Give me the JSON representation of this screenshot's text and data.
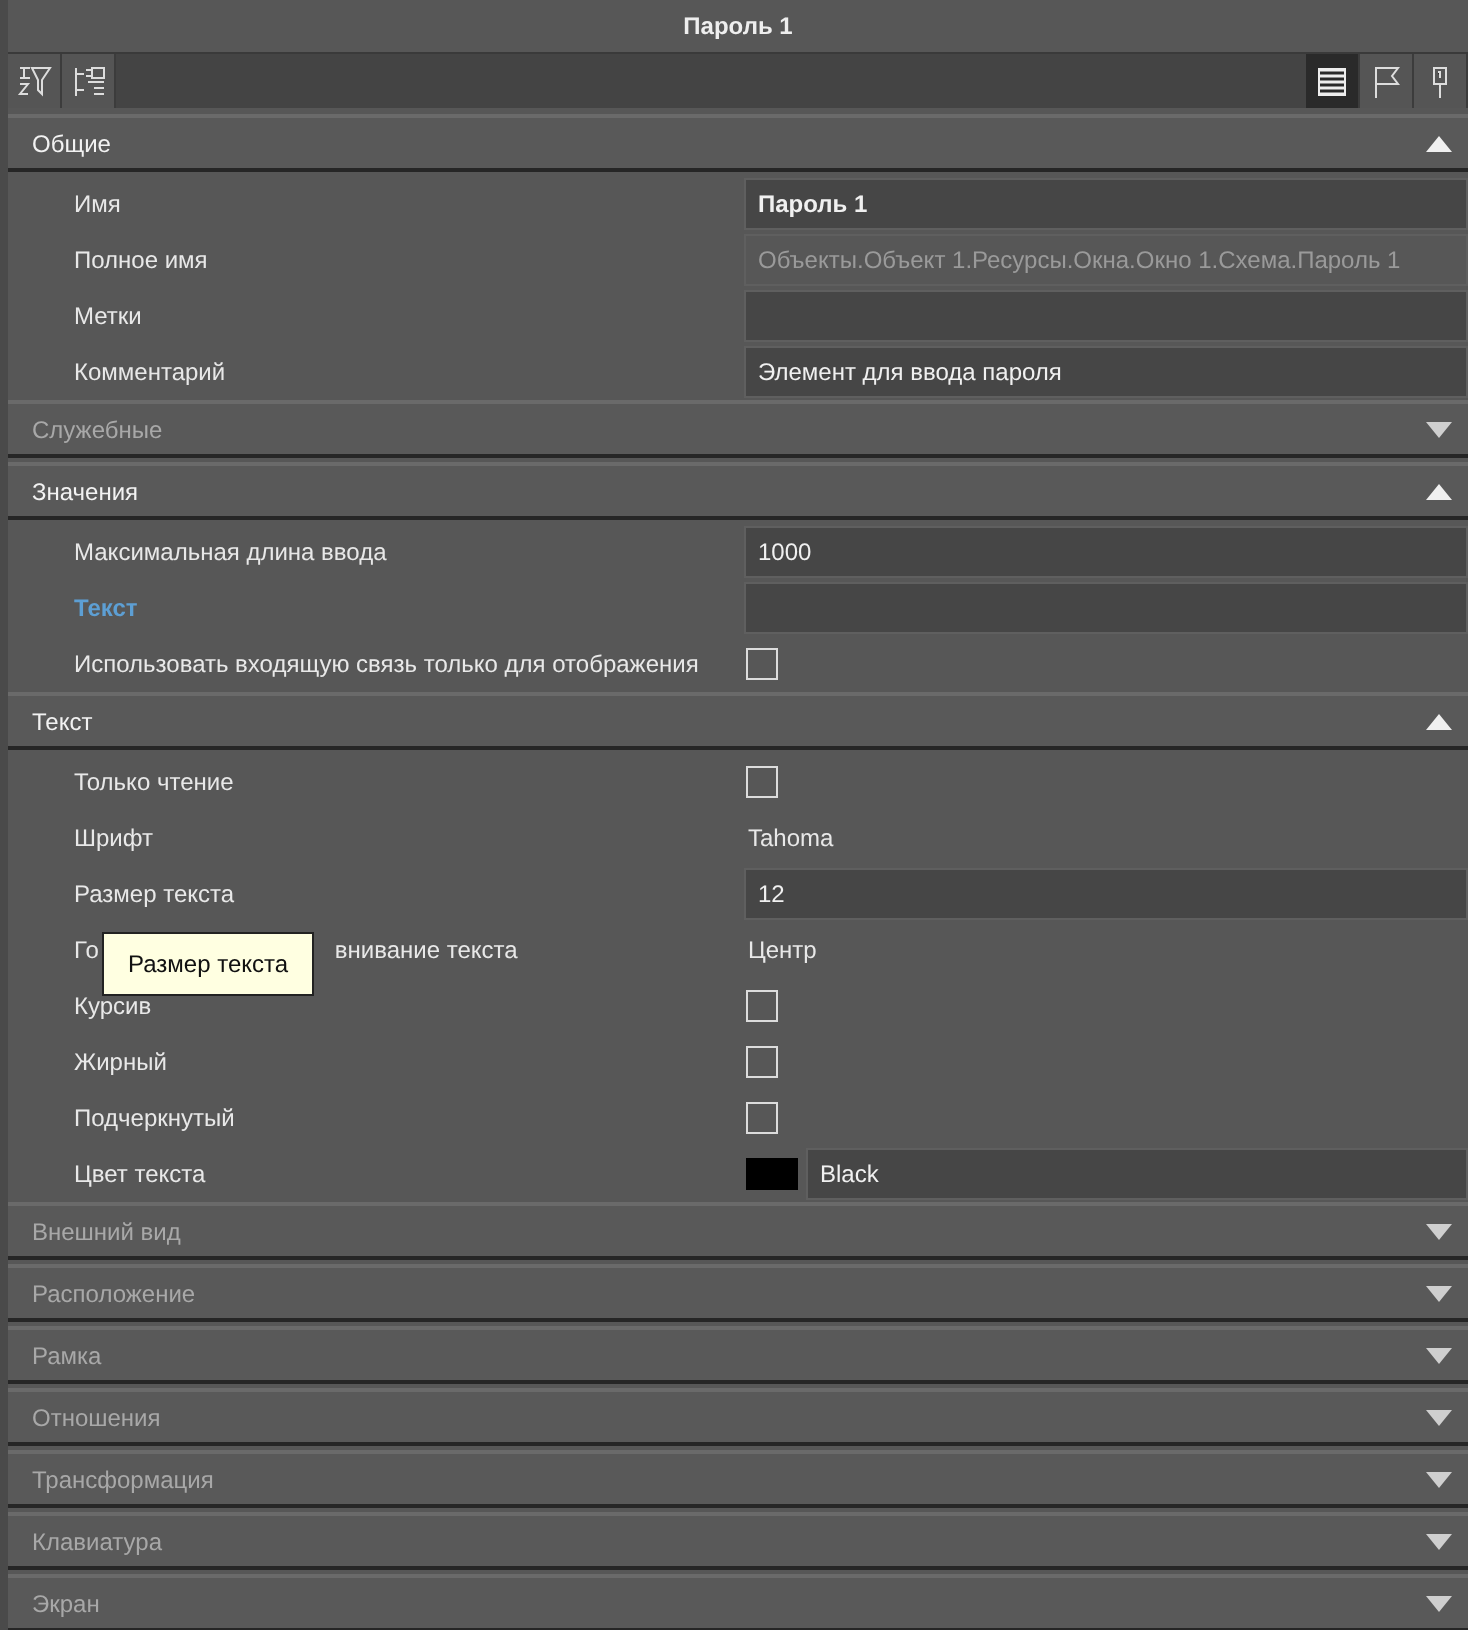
{
  "window": {
    "title": "Пароль 1"
  },
  "toolbar": {
    "left": [
      {
        "kind": "sort"
      },
      {
        "kind": "collapse"
      }
    ],
    "right": [
      {
        "kind": "list",
        "selected": true
      },
      {
        "kind": "flag",
        "selected": false
      },
      {
        "kind": "pin",
        "selected": false
      }
    ]
  },
  "sections": [
    {
      "title": "Общие",
      "expanded": true,
      "rows": [
        {
          "label": "Имя",
          "linked": false,
          "kind": "field",
          "value": "Пароль 1",
          "bold": true,
          "disabled": false
        },
        {
          "label": "Полное имя",
          "linked": false,
          "kind": "field",
          "value": "Объекты.Объект 1.Ресурсы.Окна.Окно 1.Схема.Пароль 1",
          "bold": false,
          "disabled": true
        },
        {
          "label": "Метки",
          "linked": false,
          "kind": "field",
          "bold": false,
          "disabled": false
        },
        {
          "label": "Комментарий",
          "linked": false,
          "kind": "field",
          "value": "Элемент для ввода пароля",
          "bold": false,
          "disabled": false
        }
      ]
    },
    {
      "title": "Служебные",
      "expanded": false
    },
    {
      "title": "Значения",
      "expanded": true,
      "rows": [
        {
          "label": "Максимальная длина ввода",
          "linked": false,
          "kind": "field",
          "value": "1000",
          "bold": false,
          "disabled": false
        },
        {
          "label": "Текст",
          "linked": true,
          "kind": "field",
          "bold": false,
          "disabled": false
        },
        {
          "label": "Использовать входящую связь только для отображения",
          "linked": false,
          "kind": "checkbox",
          "checked": false
        }
      ]
    },
    {
      "title": "Текст",
      "expanded": true,
      "rows": [
        {
          "label": "Только чтение",
          "linked": false,
          "kind": "checkbox",
          "checked": false
        },
        {
          "label": "Шрифт",
          "linked": false,
          "kind": "text",
          "value": "Tahoma"
        },
        {
          "label": "Размер текста",
          "linked": false,
          "kind": "field",
          "value": "12",
          "bold": false,
          "disabled": false
        },
        {
          "label_parts": [
            "Го",
            "внивание текста"
          ],
          "linked": false,
          "kind": "text",
          "value": "Центр"
        },
        {
          "label": "Курсив",
          "linked": false,
          "kind": "checkbox",
          "checked": false
        },
        {
          "label": "Жирный",
          "linked": false,
          "kind": "checkbox",
          "checked": false
        },
        {
          "label": "Подчеркнутый",
          "linked": false,
          "kind": "checkbox",
          "checked": false
        },
        {
          "label": "Цвет текста",
          "linked": false,
          "kind": "color",
          "color": "#000000",
          "value": "Black"
        }
      ]
    },
    {
      "title": "Внешний вид",
      "expanded": false
    },
    {
      "title": "Расположение",
      "expanded": false
    },
    {
      "title": "Рамка",
      "expanded": false
    },
    {
      "title": "Отношения",
      "expanded": false
    },
    {
      "title": "Трансформация",
      "expanded": false
    },
    {
      "title": "Клавиатура",
      "expanded": false
    },
    {
      "title": "Экран",
      "expanded": false
    }
  ],
  "tooltip": {
    "text": "Размер текста"
  }
}
